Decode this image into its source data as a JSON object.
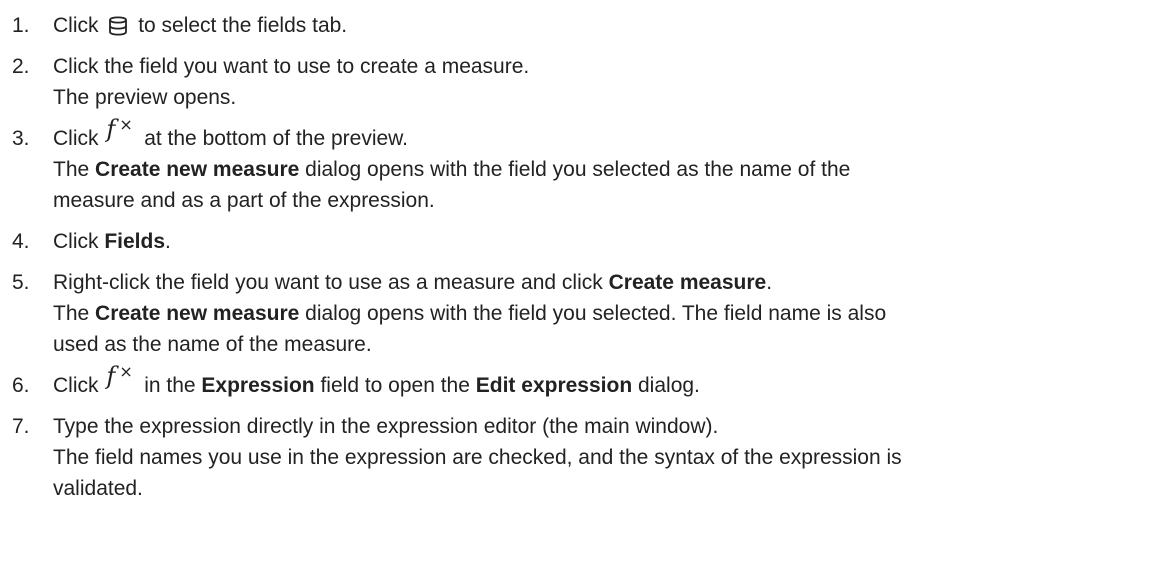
{
  "steps": [
    {
      "num": "1.",
      "before": "Click",
      "icon": "database-icon",
      "after": "to select the fields tab."
    },
    {
      "num": "2.",
      "line1": "Click the field you want to use to create a measure.",
      "line2": "The preview opens."
    },
    {
      "num": "3.",
      "before": "Click",
      "icon": "fx-icon",
      "after": "at the bottom of the preview.",
      "line2_pre": "The",
      "line2_bold": "Create new measure",
      "line2_post": "dialog opens with the field you selected as the name of the",
      "line3": "measure and as a part of the expression."
    },
    {
      "num": "4.",
      "before": "Click",
      "bold": "Fields",
      "after": "."
    },
    {
      "num": "5.",
      "line1_pre": "Right-click the field you want to use as a measure and click",
      "line1_bold": "Create measure",
      "line1_post": ".",
      "line2_pre": "The",
      "line2_bold": "Create new measure",
      "line2_post": "dialog opens with the field you selected. The field name is also",
      "line3": "used as the name of the measure."
    },
    {
      "num": "6.",
      "before": "Click",
      "icon": "fx-icon",
      "mid1": "in the",
      "bold1": "Expression",
      "mid2": "field to open the",
      "bold2": "Edit expression",
      "after": "dialog."
    },
    {
      "num": "7.",
      "line1": "Type the expression directly in the expression editor (the main window).",
      "line2": "The field names you use in the expression are checked, and the syntax of the expression is",
      "line3": "validated."
    }
  ]
}
